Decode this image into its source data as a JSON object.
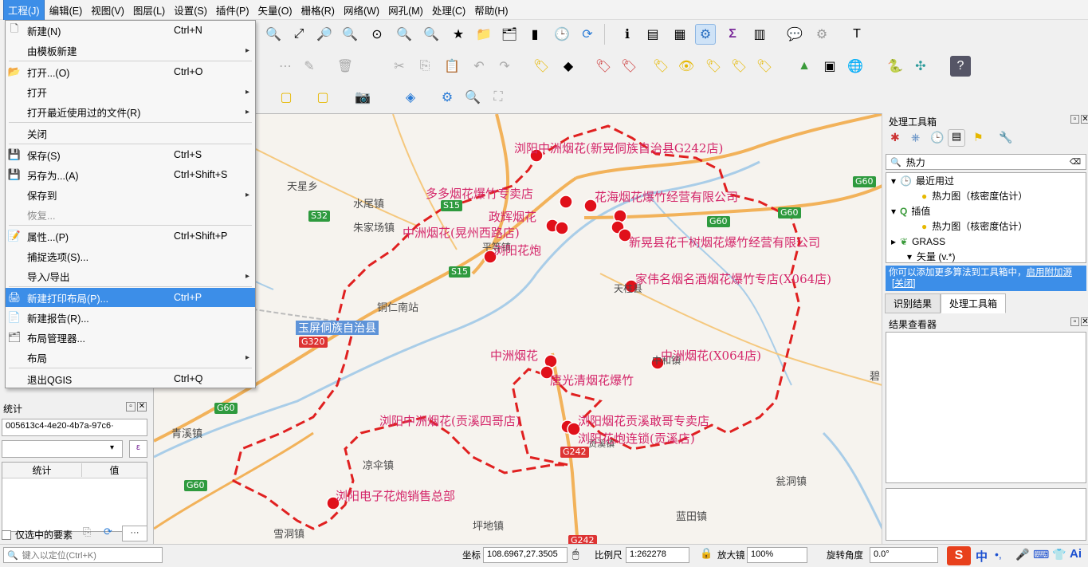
{
  "menubar": [
    "工程(J)",
    "编辑(E)",
    "视图(V)",
    "图层(L)",
    "设置(S)",
    "插件(P)",
    "矢量(O)",
    "栅格(R)",
    "网络(W)",
    "网孔(M)",
    "处理(C)",
    "帮助(H)"
  ],
  "project_menu": [
    {
      "label": "新建(N)",
      "shortcut": "Ctrl+N",
      "icon": "new-file-icon"
    },
    {
      "label": "由模板新建",
      "submenu": true
    },
    {
      "label": "打开...(O)",
      "shortcut": "Ctrl+O",
      "icon": "folder-icon"
    },
    {
      "label": "打开",
      "submenu": true
    },
    {
      "label": "打开最近使用过的文件(R)",
      "submenu": true
    },
    {
      "label": "关闭"
    },
    {
      "label": "保存(S)",
      "shortcut": "Ctrl+S",
      "icon": "save-icon"
    },
    {
      "label": "另存为...(A)",
      "shortcut": "Ctrl+Shift+S",
      "icon": "save-as-icon"
    },
    {
      "label": "保存到",
      "submenu": true
    },
    {
      "label": "恢复...",
      "disabled": true
    },
    {
      "label": "属性...(P)",
      "shortcut": "Ctrl+Shift+P",
      "icon": "properties-icon"
    },
    {
      "label": "捕捉选项(S)..."
    },
    {
      "label": "导入/导出",
      "submenu": true
    },
    {
      "label": "新建打印布局(P)...",
      "shortcut": "Ctrl+P",
      "icon": "print-layout-icon",
      "highlighted": true
    },
    {
      "label": "新建报告(R)...",
      "icon": "report-icon"
    },
    {
      "label": "布局管理器...",
      "icon": "layout-manager-icon"
    },
    {
      "label": "布局",
      "submenu": true
    },
    {
      "label": "退出QGIS",
      "shortcut": "Ctrl+Q"
    }
  ],
  "left": {
    "stats_title": "统计",
    "layer_value": "005613c4-4e20-4b7a-97c6·",
    "col_stat": "统计",
    "col_value": "值",
    "selected_only": "仅选中的要素",
    "locate_placeholder": "键入以定位(Ctrl+K)"
  },
  "right": {
    "toolbox_title": "处理工具箱",
    "search_value": "热力",
    "tree": {
      "recent": "最近用过",
      "recent_item": "热力图（核密度估计）",
      "interp": "插值",
      "interp_item": "热力图（核密度估计）",
      "grass": "GRASS",
      "vector": "矢量 (v.*)"
    },
    "notice": "你可以添加更多算法到工具箱中，",
    "notice_link1": "启用附加源",
    "notice_link2": "[关闭]",
    "tab_identify": "识别结果",
    "tab_toolbox": "处理工具箱",
    "results_title": "结果查看器"
  },
  "map": {
    "places": [
      "天星乡",
      "水尾镇",
      "朱家场镇",
      "平等镇",
      "铜仁南站",
      "玉屏侗族自治县",
      "凉伞镇",
      "青溪镇",
      "坪地镇",
      "蓝田镇",
      "雪洞镇",
      "贡溪镇",
      "天柱县",
      "中和镇",
      "瓮洞镇",
      "碧"
    ],
    "roads": [
      "S32",
      "S15",
      "S15",
      "G60",
      "G60",
      "G60",
      "G60",
      "G320",
      "G60",
      "G242",
      "G242"
    ],
    "shops": [
      "浏阳中洲烟花(新晃侗族自治县G242店)",
      "多多烟花爆竹专卖店",
      "花海烟花爆竹经营有限公司",
      "政辉烟花",
      "中洲烟花(晃州西路店)",
      "新晃县花千树烟花爆竹经营有限公司",
      "浏阳花炮",
      "家伟名烟名酒烟花爆竹专店(X064店)",
      "中洲烟花",
      "中洲烟花(X064店)",
      "唐光清烟花爆竹",
      "浏阳中洲烟花(贡溪四哥店)",
      "浏阳烟花贡溪敢哥专卖店",
      "浏阳花炮连锁(贡溪店)",
      "浏阳电子花炮销售总部"
    ]
  },
  "status": {
    "coord_label": "坐标",
    "coord_value": "108.6967,27.3505",
    "scale_label": "比例尺",
    "scale_value": "1:262278",
    "magnifier_label": "放大镜",
    "magnifier_value": "100%",
    "rotation_label": "旋转角度",
    "rotation_value": "0.0°",
    "ime": "中"
  },
  "colors": {
    "accent": "#3c8ee8",
    "shop": "#d4276a",
    "marker": "#e0101a",
    "boundary": "#e02020"
  }
}
